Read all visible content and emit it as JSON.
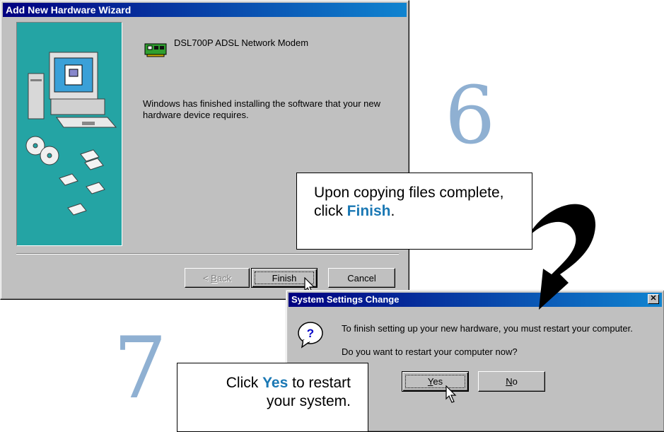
{
  "wizard": {
    "title": "Add New Hardware Wizard",
    "device_name": "DSL700P ADSL Network Modem",
    "message": "Windows has finished installing the software that your new hardware device requires.",
    "back_label_pre": "< ",
    "back_label_key": "B",
    "back_label_post": "ack",
    "finish_label": "Finish",
    "cancel_label": "Cancel"
  },
  "dialog": {
    "title": "System Settings Change",
    "close_glyph": "✕",
    "message": "To finish setting up your new hardware, you must restart your computer.",
    "question": "Do you want to restart your computer now?",
    "yes_key": "Y",
    "yes_rest": "es",
    "no_key": "N",
    "no_rest": "o"
  },
  "steps": {
    "step6_number": "6",
    "step6_pre": "Upon copying files complete, click ",
    "step6_key": "Finish",
    "step6_post": ".",
    "step7_number": "7",
    "step7_pre": "Click ",
    "step7_key": "Yes",
    "step7_post": " to restart your system."
  },
  "colors": {
    "title_bar": "#000080",
    "wizard_panel": "#24a4a4",
    "highlight": "#1a78b4",
    "step_number": "#8fb0d2"
  }
}
